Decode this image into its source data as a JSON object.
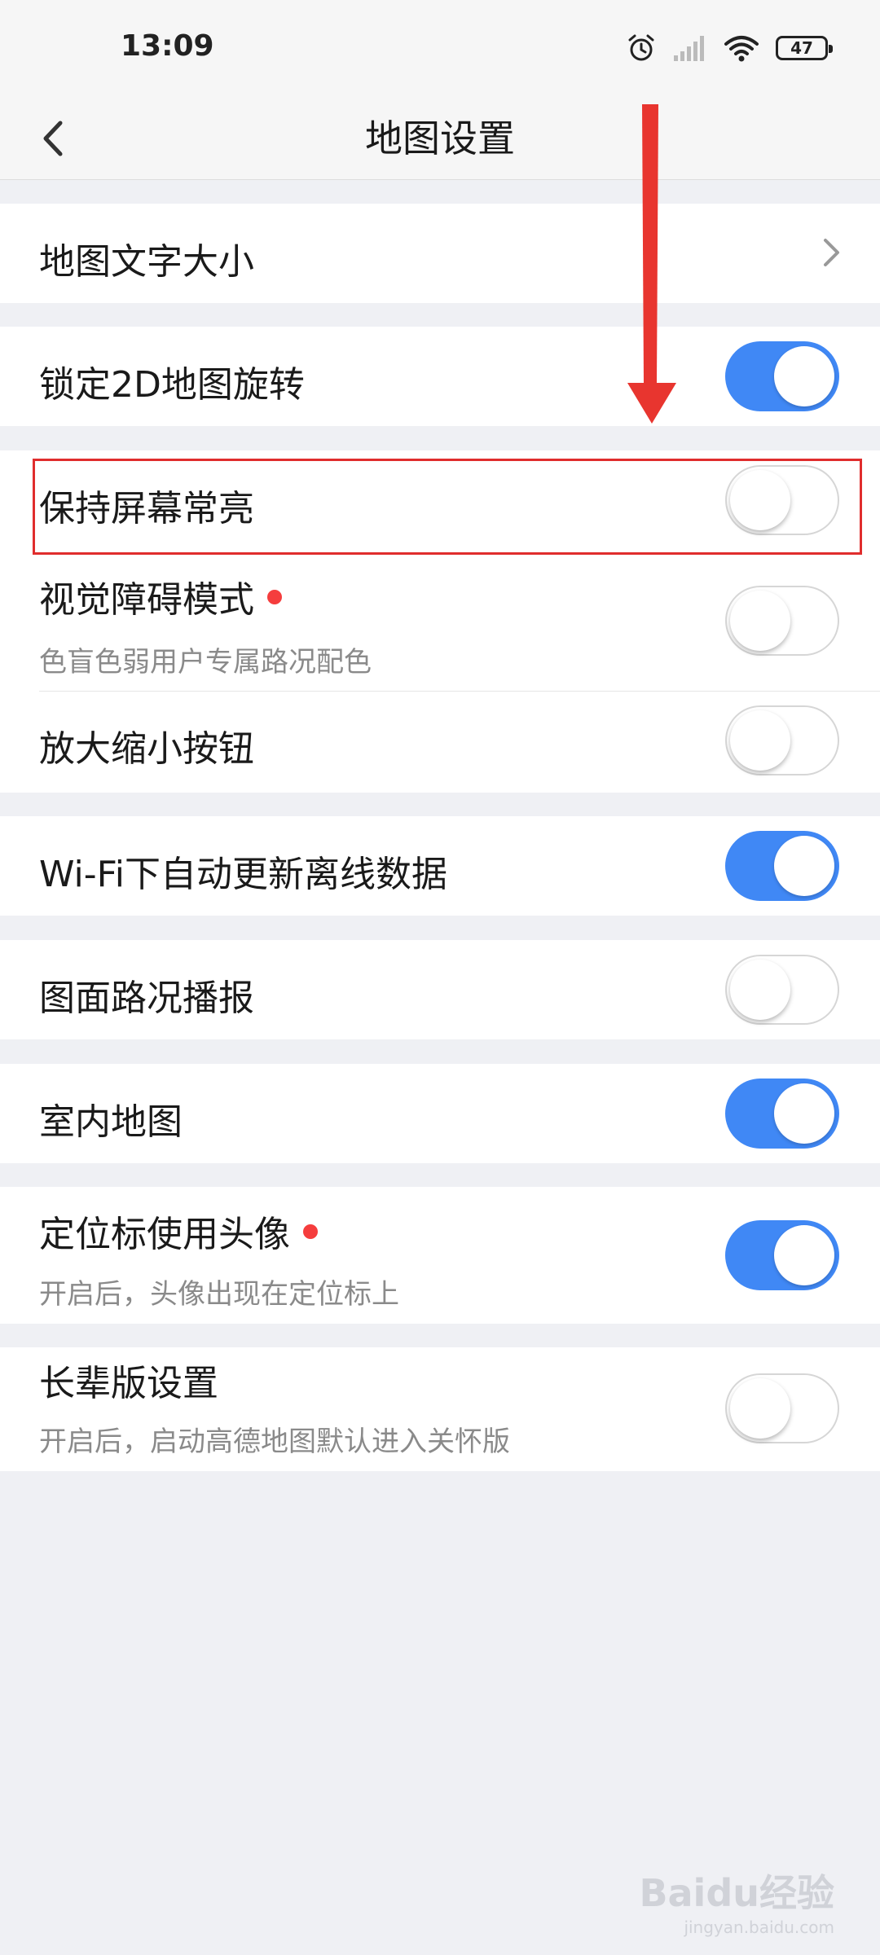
{
  "status_bar": {
    "time": "13:09",
    "battery": "47",
    "icons": [
      "alarm-icon",
      "signal-icon",
      "wifi-icon",
      "battery-icon"
    ]
  },
  "nav": {
    "title": "地图设置",
    "back_icon": "chevron-left-icon"
  },
  "settings": {
    "text_size": {
      "label": "地图文字大小"
    },
    "lock_2d_rotation": {
      "label": "锁定2D地图旋转",
      "enabled": true
    },
    "keep_screen_on": {
      "label": "保持屏幕常亮",
      "enabled": false
    },
    "visual_impairment_mode": {
      "label": "视觉障碍模式",
      "subtitle": "色盲色弱用户专属路况配色",
      "enabled": false,
      "new_dot": true
    },
    "zoom_buttons": {
      "label": "放大缩小按钮",
      "enabled": false
    },
    "wifi_offline_update": {
      "label": "Wi-Fi下自动更新离线数据",
      "enabled": true
    },
    "traffic_broadcast": {
      "label": "图面路况播报",
      "enabled": false
    },
    "indoor_map": {
      "label": "室内地图",
      "enabled": true
    },
    "avatar_location_marker": {
      "label": "定位标使用头像",
      "subtitle": "开启后，头像出现在定位标上",
      "enabled": true,
      "new_dot": true
    },
    "elder_mode": {
      "label": "长辈版设置",
      "subtitle": "开启后，启动高德地图默认进入关怀版",
      "enabled": false
    }
  },
  "watermark": {
    "main": "Baidu经验",
    "sub": "jingyan.baidu.com"
  },
  "colors": {
    "toggle_on": "#4088f5",
    "background": "#eff0f4",
    "highlight": "#e02d2d",
    "new_dot": "#f53d3d"
  }
}
